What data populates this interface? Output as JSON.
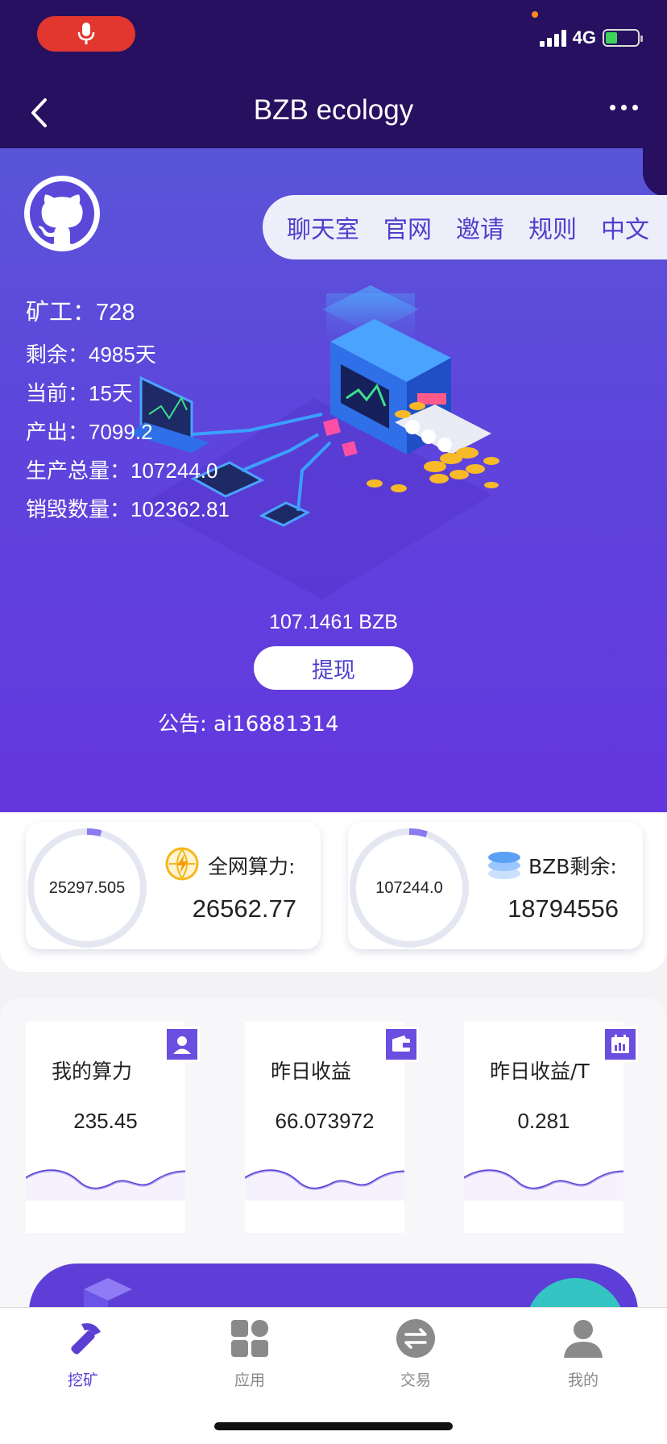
{
  "nav": {
    "title": "BZB ecology",
    "network": "4G"
  },
  "hero": {
    "menu": [
      "聊天室",
      "官网",
      "邀请",
      "规则",
      "中文"
    ],
    "stats": [
      {
        "label": "矿工：",
        "value": "728"
      },
      {
        "label": "剩余：",
        "value": "4985天"
      },
      {
        "label": "当前：",
        "value": "15天"
      },
      {
        "label": "产出：",
        "value": "7099.2"
      },
      {
        "label": "生产总量：",
        "value": "107244.0"
      },
      {
        "label": "销毁数量：",
        "value": "102362.81"
      }
    ],
    "balance": "107.1461 BZB",
    "withdraw_label": "提现",
    "notice": "公告: ai16881314"
  },
  "summary": {
    "network_power": {
      "ring_value": "25297.505",
      "label": "全网算力:",
      "value": "26562.77",
      "ring_fraction": 0.04
    },
    "bzb_remaining": {
      "ring_value": "107244.0",
      "label": "BZB剩余:",
      "value": "18794556",
      "ring_fraction": 0.05
    }
  },
  "metrics": [
    {
      "label": "我的算力",
      "value": "235.45",
      "icon": "user-icon"
    },
    {
      "label": "昨日收益",
      "value": "66.073972",
      "icon": "wallet-icon"
    },
    {
      "label": "昨日收益/T",
      "value": "0.281",
      "icon": "calendar-icon"
    }
  ],
  "tabs": [
    {
      "label": "挖矿",
      "icon": "pickaxe-icon",
      "active": true
    },
    {
      "label": "应用",
      "icon": "grid-icon",
      "active": false
    },
    {
      "label": "交易",
      "icon": "exchange-icon",
      "active": false
    },
    {
      "label": "我的",
      "icon": "person-icon",
      "active": false
    }
  ],
  "colors": {
    "accent": "#5b3fd5",
    "topbar": "#26105f",
    "hero": "#5e44dc"
  }
}
